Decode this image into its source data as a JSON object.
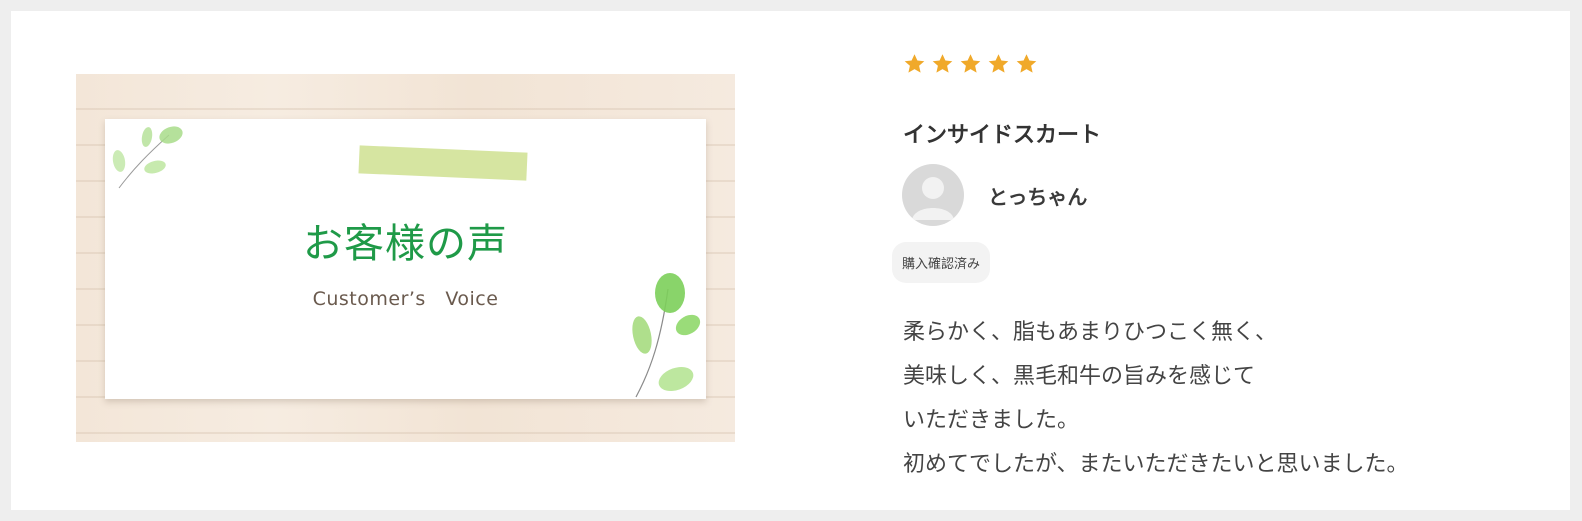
{
  "banner": {
    "title": "お客様の声",
    "subtitle": "Customer’s　Voice"
  },
  "review": {
    "rating": 5,
    "rating_max": 5,
    "star_color": "#f0a92a",
    "product_name": "インサイドスカート",
    "reviewer_name": "とっちゃん",
    "badge": "購入確認済み",
    "body_lines": [
      "柔らかく、脂もあまりひつこく無く、",
      "美味しく、黒毛和牛の旨みを感じて",
      "いただきました。",
      "初めてでしたが、またいただきたいと思いました。"
    ]
  },
  "colors": {
    "page_bg": "#eeeeee",
    "card_bg": "#ffffff",
    "title_green": "#1f9a48"
  }
}
